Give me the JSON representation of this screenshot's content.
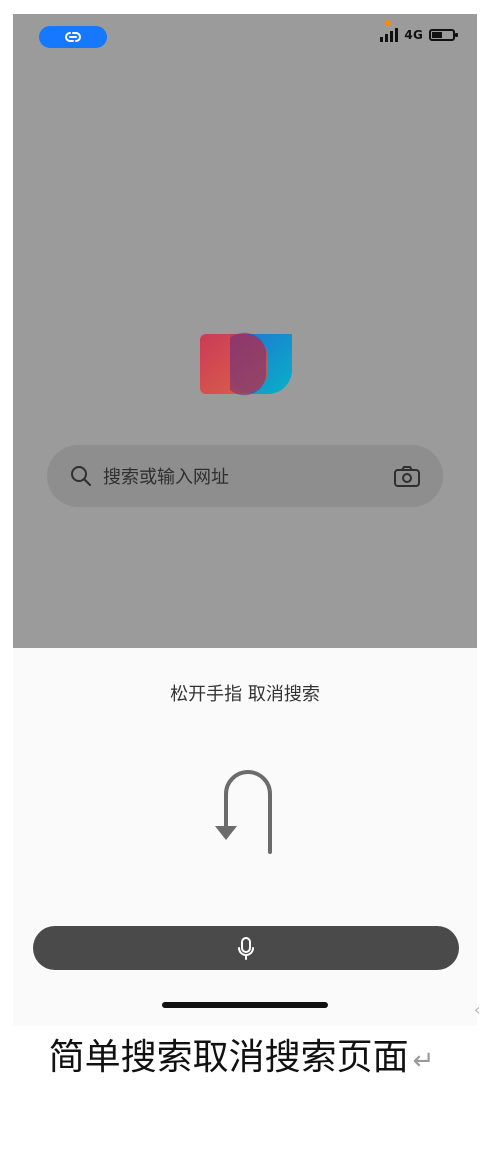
{
  "status_bar": {
    "network": "4G"
  },
  "search": {
    "placeholder": "搜索或输入网址"
  },
  "cancel": {
    "title": "松开手指 取消搜索"
  },
  "caption": {
    "text": "简单搜索取消搜索页面",
    "return_symbol": "↵"
  },
  "colors": {
    "dim": "#9b9b9b",
    "pill": "#1677ff",
    "mic_bar": "#4a4a4a",
    "sheet": "#fafafa"
  },
  "icons": {
    "status_pill": "link-icon",
    "search": "search-icon",
    "camera": "camera-icon",
    "mic": "mic-icon",
    "uturn": "u-turn-arrow-icon"
  }
}
